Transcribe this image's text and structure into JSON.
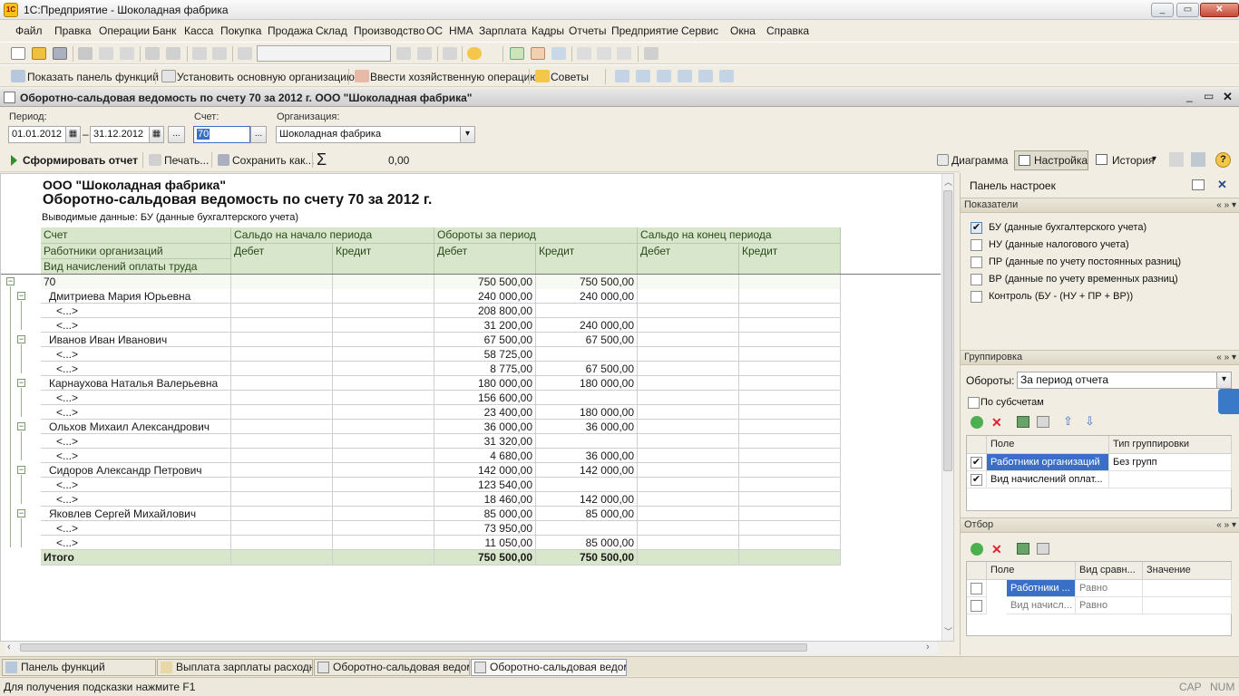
{
  "window": {
    "title": "1С:Предприятие - Шоколадная фабрика",
    "app_icon": "1С"
  },
  "window_controls": {
    "minimize": "_",
    "restore": "▭",
    "close": "✕"
  },
  "menu": [
    "Файл",
    "Правка",
    "Операции",
    "Банк",
    "Касса",
    "Покупка",
    "Продажа",
    "Склад",
    "Производство",
    "ОС",
    "НМА",
    "Зарплата",
    "Кадры",
    "Отчеты",
    "Предприятие",
    "Сервис",
    "Окна",
    "Справка"
  ],
  "toolbar2": {
    "show_panel": "Показать панель функций",
    "set_org": "Установить основную организацию",
    "enter_op": "Ввести хозяйственную операцию",
    "tips": "Советы"
  },
  "document": {
    "title": "Оборотно-сальдовая ведомость по счету 70 за 2012 г. ООО \"Шоколадная фабрика\""
  },
  "filters": {
    "period_label": "Период:",
    "date_from": "01.01.2012",
    "dash": "–",
    "date_to": "31.12.2012",
    "ellipsis": "...",
    "account_label": "Счет:",
    "account_value": "70",
    "org_label": "Организация:",
    "org_value": "Шоколадная фабрика"
  },
  "actions": {
    "generate": "Сформировать отчет",
    "print": "Печать...",
    "save": "Сохранить как...",
    "sigma": "Σ",
    "sum_value": "0,00",
    "diagram": "Диаграмма",
    "settings": "Настройка",
    "history": "История"
  },
  "report": {
    "org": "ООО \"Шоколадная фабрика\"",
    "title": "Оборотно-сальдовая ведомость по счету 70 за 2012 г.",
    "subtitle": "Выводимые данные:  БУ (данные бухгалтерского учета)",
    "headers": {
      "account": "Счет",
      "employees": "Работники организаций",
      "accrual_type": "Вид начислений оплаты труда",
      "opening": "Сальдо на начало периода",
      "turnover": "Обороты за период",
      "closing": "Сальдо на конец периода",
      "debit": "Дебет",
      "credit": "Кредит"
    },
    "rows": [
      {
        "level": 0,
        "name": "70",
        "d1": "",
        "c1": "",
        "d2": "750 500,00",
        "c2": "750 500,00",
        "d3": "",
        "c3": ""
      },
      {
        "level": 1,
        "name": "Дмитриева Мария Юрьевна",
        "d1": "",
        "c1": "",
        "d2": "240 000,00",
        "c2": "240 000,00",
        "d3": "",
        "c3": ""
      },
      {
        "level": 2,
        "name": "<...>",
        "d1": "",
        "c1": "",
        "d2": "208 800,00",
        "c2": "",
        "d3": "",
        "c3": ""
      },
      {
        "level": 2,
        "name": "<...>",
        "d1": "",
        "c1": "",
        "d2": "31 200,00",
        "c2": "240 000,00",
        "d3": "",
        "c3": ""
      },
      {
        "level": 1,
        "name": "Иванов Иван Иванович",
        "d1": "",
        "c1": "",
        "d2": "67 500,00",
        "c2": "67 500,00",
        "d3": "",
        "c3": ""
      },
      {
        "level": 2,
        "name": "<...>",
        "d1": "",
        "c1": "",
        "d2": "58 725,00",
        "c2": "",
        "d3": "",
        "c3": ""
      },
      {
        "level": 2,
        "name": "<...>",
        "d1": "",
        "c1": "",
        "d2": "8 775,00",
        "c2": "67 500,00",
        "d3": "",
        "c3": ""
      },
      {
        "level": 1,
        "name": "Карнаухова Наталья Валерьевна",
        "d1": "",
        "c1": "",
        "d2": "180 000,00",
        "c2": "180 000,00",
        "d3": "",
        "c3": ""
      },
      {
        "level": 2,
        "name": "<...>",
        "d1": "",
        "c1": "",
        "d2": "156 600,00",
        "c2": "",
        "d3": "",
        "c3": ""
      },
      {
        "level": 2,
        "name": "<...>",
        "d1": "",
        "c1": "",
        "d2": "23 400,00",
        "c2": "180 000,00",
        "d3": "",
        "c3": ""
      },
      {
        "level": 1,
        "name": "Ольхов Михаил Александрович",
        "d1": "",
        "c1": "",
        "d2": "36 000,00",
        "c2": "36 000,00",
        "d3": "",
        "c3": ""
      },
      {
        "level": 2,
        "name": "<...>",
        "d1": "",
        "c1": "",
        "d2": "31 320,00",
        "c2": "",
        "d3": "",
        "c3": ""
      },
      {
        "level": 2,
        "name": "<...>",
        "d1": "",
        "c1": "",
        "d2": "4 680,00",
        "c2": "36 000,00",
        "d3": "",
        "c3": ""
      },
      {
        "level": 1,
        "name": "Сидоров Александр Петрович",
        "d1": "",
        "c1": "",
        "d2": "142 000,00",
        "c2": "142 000,00",
        "d3": "",
        "c3": ""
      },
      {
        "level": 2,
        "name": "<...>",
        "d1": "",
        "c1": "",
        "d2": "123 540,00",
        "c2": "",
        "d3": "",
        "c3": ""
      },
      {
        "level": 2,
        "name": "<...>",
        "d1": "",
        "c1": "",
        "d2": "18 460,00",
        "c2": "142 000,00",
        "d3": "",
        "c3": ""
      },
      {
        "level": 1,
        "name": "Яковлев Сергей Михайлович",
        "d1": "",
        "c1": "",
        "d2": "85 000,00",
        "c2": "85 000,00",
        "d3": "",
        "c3": ""
      },
      {
        "level": 2,
        "name": "<...>",
        "d1": "",
        "c1": "",
        "d2": "73 950,00",
        "c2": "",
        "d3": "",
        "c3": ""
      },
      {
        "level": 2,
        "name": "<...>",
        "d1": "",
        "c1": "",
        "d2": "11 050,00",
        "c2": "85 000,00",
        "d3": "",
        "c3": ""
      }
    ],
    "total": {
      "name": "Итого",
      "d1": "",
      "c1": "",
      "d2": "750 500,00",
      "c2": "750 500,00",
      "d3": "",
      "c3": ""
    }
  },
  "settings_panel": {
    "title": "Панель настроек",
    "indicators_title": "Показатели",
    "indicators": [
      {
        "label": "БУ (данные бухгалтерского учета)",
        "checked": true
      },
      {
        "label": "НУ (данные налогового учета)",
        "checked": false
      },
      {
        "label": "ПР (данные по учету постоянных разниц)",
        "checked": false
      },
      {
        "label": "ВР (данные по учету временных разниц)",
        "checked": false
      },
      {
        "label": "Контроль (БУ - (НУ + ПР + ВР))",
        "checked": false
      }
    ],
    "grouping_title": "Группировка",
    "turnover_label": "Обороты:",
    "turnover_value": "За период отчета",
    "subaccounts_label": "По субсчетам",
    "grouping_headers": {
      "field": "Поле",
      "type": "Тип группировки"
    },
    "grouping_rows": [
      {
        "field": "Работники организаций",
        "type": "Без групп",
        "checked": true
      },
      {
        "field": "Вид начислений оплат...",
        "type": "",
        "checked": true
      }
    ],
    "filter_title": "Отбор",
    "filter_headers": {
      "field": "Поле",
      "comparison": "Вид сравн...",
      "value": "Значение"
    },
    "filter_rows": [
      {
        "field": "Работники ...",
        "comparison": "Равно",
        "value": ""
      },
      {
        "field": "Вид начисл...",
        "comparison": "Равно",
        "value": ""
      }
    ],
    "arrows": "« » ▾"
  },
  "taskbar": [
    {
      "label": "Панель функций",
      "active": false
    },
    {
      "label": "Выплата зарплаты расходн...",
      "active": false
    },
    {
      "label": "Оборотно-сальдовая ведом...",
      "active": false
    },
    {
      "label": "Оборотно-сальдовая ведом...",
      "active": true
    }
  ],
  "status": {
    "hint": "Для получения подсказки нажмите F1",
    "cap": "CAP",
    "num": "NUM"
  }
}
